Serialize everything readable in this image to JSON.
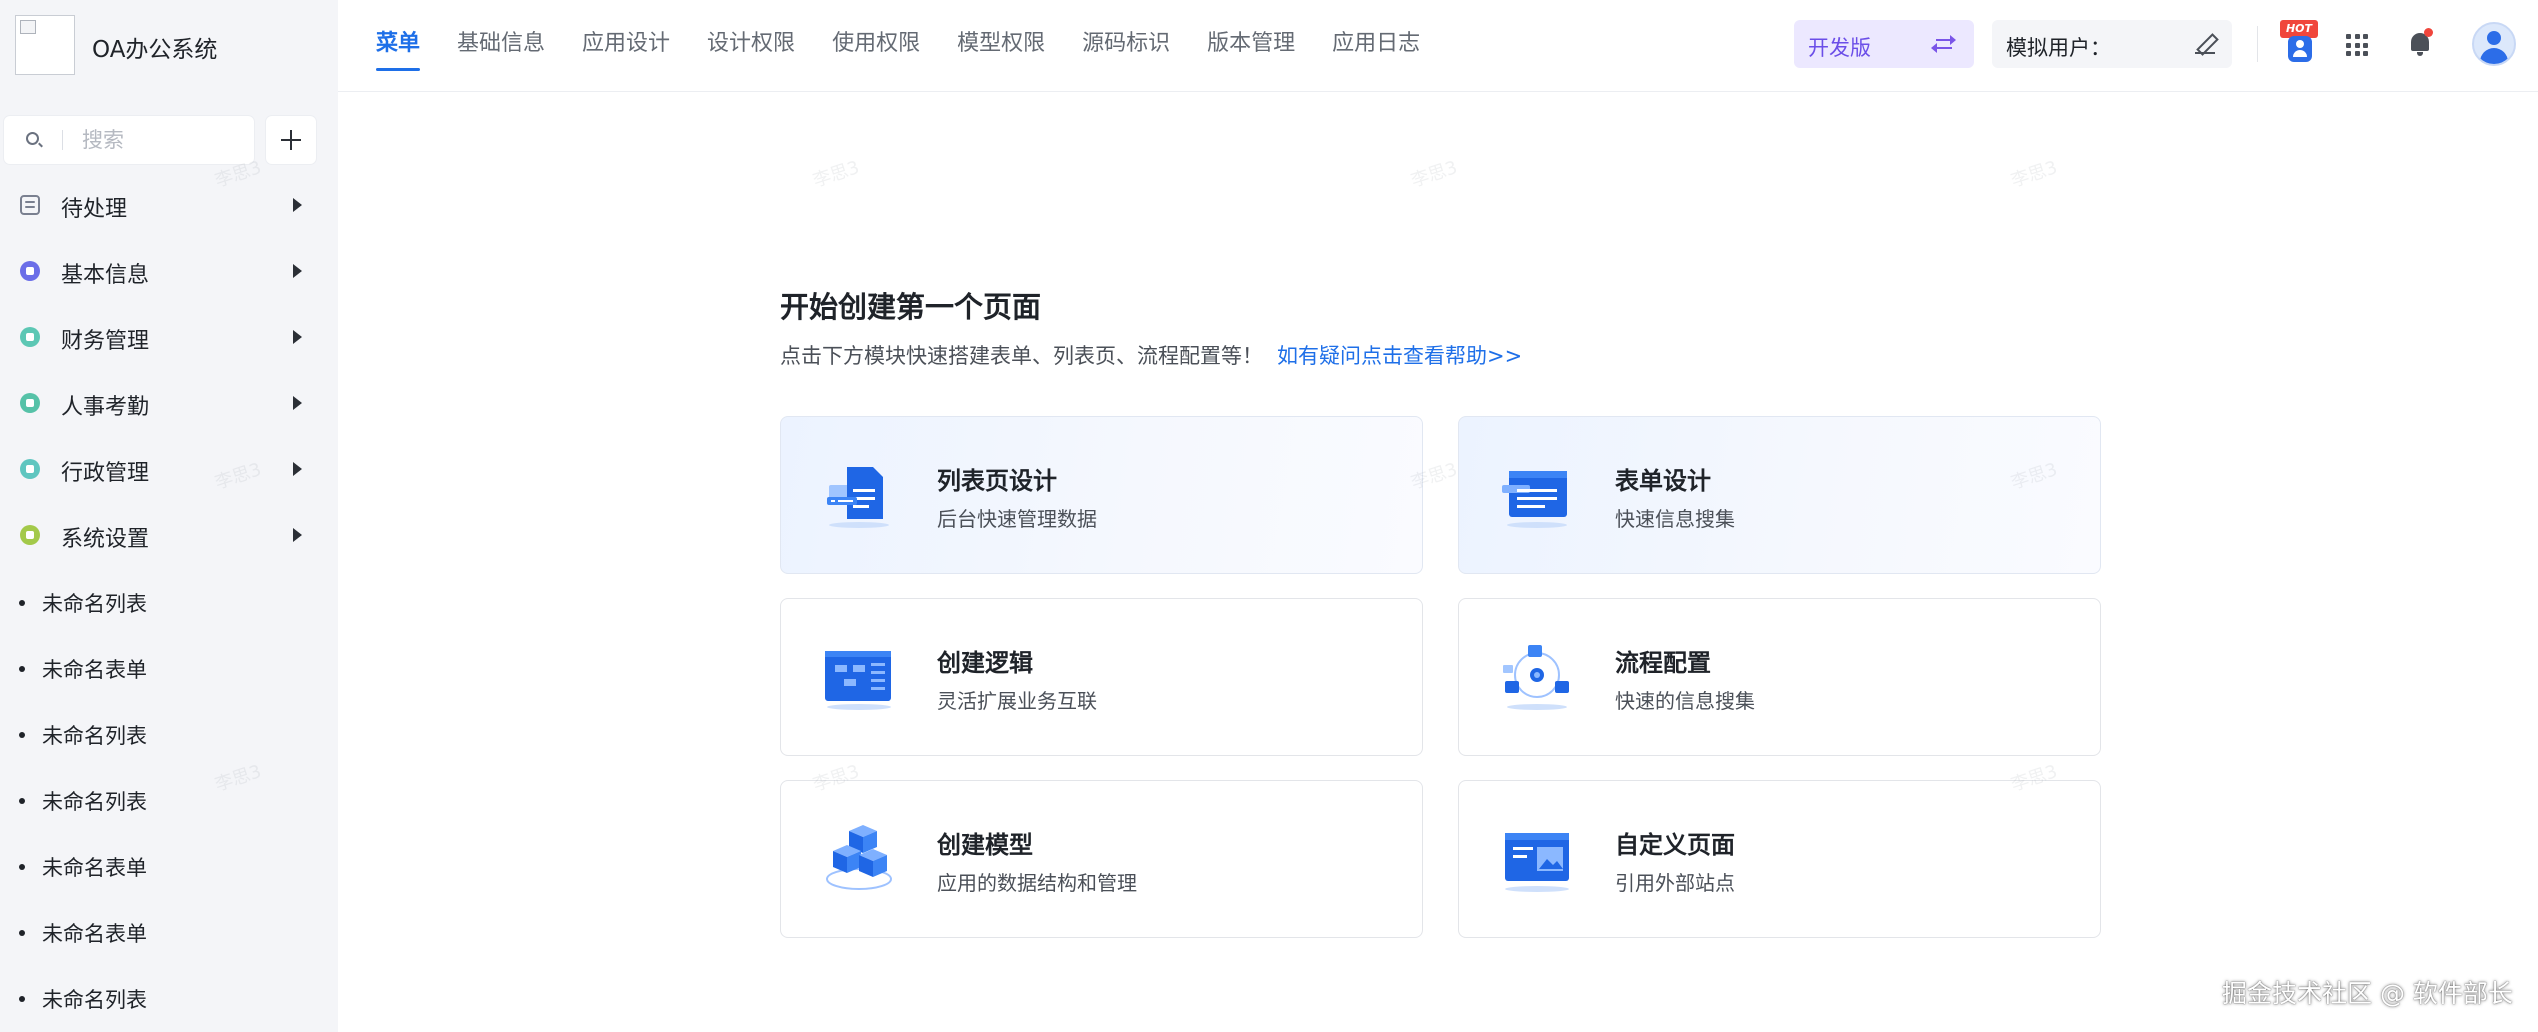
{
  "app": {
    "title": "OA办公系统"
  },
  "sidebar": {
    "search_placeholder": "搜索",
    "menu": [
      {
        "label": "待处理"
      },
      {
        "label": "基本信息"
      },
      {
        "label": "财务管理"
      },
      {
        "label": "人事考勤"
      },
      {
        "label": "行政管理"
      },
      {
        "label": "系统设置"
      }
    ],
    "items": [
      {
        "label": "未命名列表"
      },
      {
        "label": "未命名表单"
      },
      {
        "label": "未命名列表"
      },
      {
        "label": "未命名列表"
      },
      {
        "label": "未命名表单"
      },
      {
        "label": "未命名表单"
      },
      {
        "label": "未命名列表"
      }
    ]
  },
  "topnav": {
    "tabs": [
      "菜单",
      "基础信息",
      "应用设计",
      "设计权限",
      "使用权限",
      "模型权限",
      "源码标识",
      "版本管理",
      "应用日志"
    ],
    "env_label": "开发版",
    "mock_user_label": "模拟用户：",
    "hot_badge": "HOT"
  },
  "main": {
    "title": "开始创建第一个页面",
    "subtitle": "点击下方模块快速搭建表单、列表页、流程配置等！",
    "help_link": "如有疑问点击查看帮助>>",
    "cards": [
      {
        "title": "列表页设计",
        "desc": "后台快速管理数据"
      },
      {
        "title": "表单设计",
        "desc": "快速信息搜集"
      },
      {
        "title": "创建逻辑",
        "desc": "灵活扩展业务互联"
      },
      {
        "title": "流程配置",
        "desc": "快速的信息搜集"
      },
      {
        "title": "创建模型",
        "desc": "应用的数据结构和管理"
      },
      {
        "title": "自定义页面",
        "desc": "引用外部站点"
      }
    ]
  },
  "watermark_text": "李思3",
  "footer_mark": "掘金技术社区 @ 软件部长",
  "colors": {
    "accent": "#1e6fe8",
    "env_bg": "#ece8ff",
    "env_text": "#6b4ee8",
    "sidebar_bg": "#f4f5f8"
  }
}
